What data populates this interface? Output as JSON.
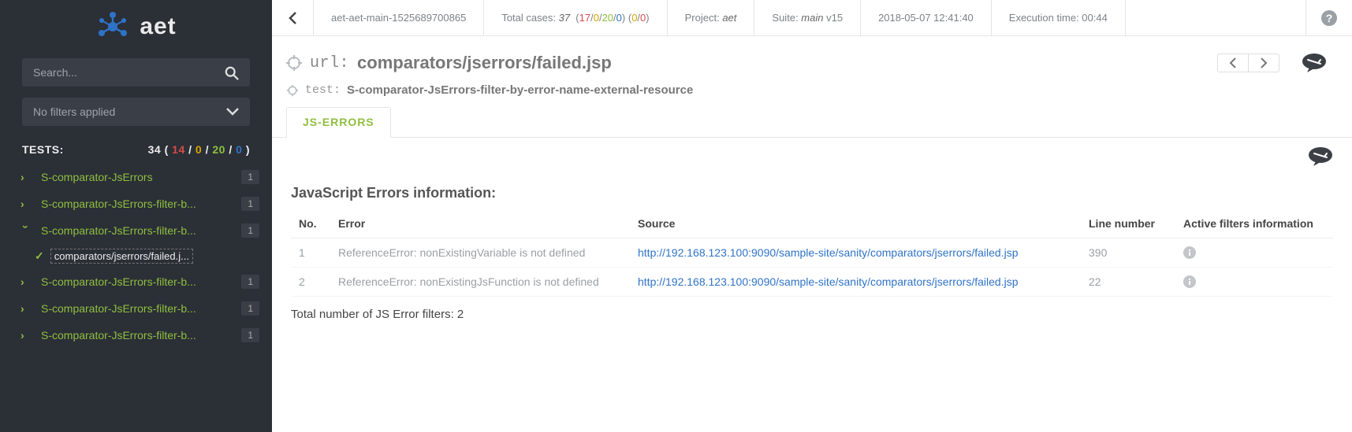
{
  "brand": "aet",
  "search": {
    "placeholder": "Search..."
  },
  "filters": {
    "label": "No filters applied"
  },
  "tests_header": {
    "label": "TESTS:",
    "total": "34",
    "red": "14",
    "yellow": "0",
    "green": "20",
    "blue": "0"
  },
  "sidebar": {
    "items": [
      {
        "label": "S-comparator-JsErrors",
        "badge": "1",
        "expanded": false
      },
      {
        "label": "S-comparator-JsErrors-filter-b...",
        "badge": "1",
        "expanded": false
      },
      {
        "label": "S-comparator-JsErrors-filter-b...",
        "badge": "1",
        "expanded": true,
        "child": {
          "label": "comparators/jserrors/failed.j..."
        }
      },
      {
        "label": "S-comparator-JsErrors-filter-b...",
        "badge": "1",
        "expanded": false
      },
      {
        "label": "S-comparator-JsErrors-filter-b...",
        "badge": "1",
        "expanded": false
      },
      {
        "label": "S-comparator-JsErrors-filter-b...",
        "badge": "1",
        "expanded": false
      }
    ]
  },
  "topbar": {
    "suite_run": "aet-aet-main-1525689700865",
    "cases_label": "Total cases:",
    "cases_total": "37",
    "cases_red": "17",
    "cases_yellow": "0",
    "cases_green": "20",
    "cases_blue": "0",
    "extra_a": "0",
    "extra_b": "0",
    "project_label": "Project:",
    "project": "aet",
    "suite_label": "Suite:",
    "suite": "main",
    "suite_ver": "v15",
    "timestamp": "2018-05-07 12:41:40",
    "exec_label": "Execution time:",
    "exec_time": "00:44"
  },
  "url": {
    "label": "url:",
    "value": "comparators/jserrors/failed.jsp"
  },
  "testline": {
    "label": "test:",
    "value": "S-comparator-JsErrors-filter-by-error-name-external-resource"
  },
  "tab": {
    "label": "JS-ERRORS"
  },
  "table": {
    "title": "JavaScript Errors information:",
    "headers": {
      "no": "No.",
      "error": "Error",
      "source": "Source",
      "line": "Line number",
      "filters": "Active filters information"
    },
    "rows": [
      {
        "no": "1",
        "error": "ReferenceError: nonExistingVariable is not defined",
        "source": "http://192.168.123.100:9090/sample-site/sanity/comparators/jserrors/failed.jsp",
        "line": "390"
      },
      {
        "no": "2",
        "error": "ReferenceError: nonExistingJsFunction is not defined",
        "source": "http://192.168.123.100:9090/sample-site/sanity/comparators/jserrors/failed.jsp",
        "line": "22"
      }
    ],
    "total": "Total number of JS Error filters: 2"
  }
}
